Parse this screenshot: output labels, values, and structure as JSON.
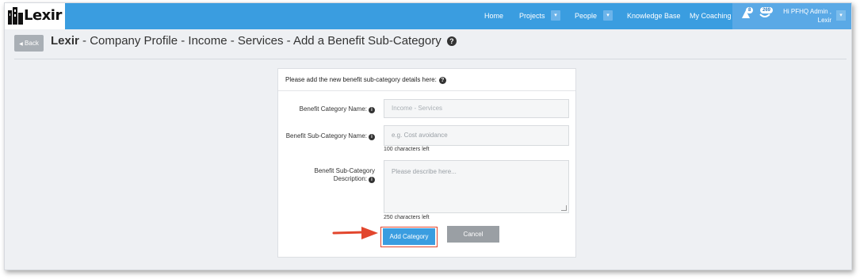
{
  "brand": {
    "logo_text": "Lexir"
  },
  "nav": {
    "items": [
      {
        "label": "Home"
      },
      {
        "label": "Projects"
      },
      {
        "label": "People"
      },
      {
        "label": "Knowledge Base"
      },
      {
        "label": "My Coaching"
      }
    ],
    "notifications": {
      "alerts_count": "8",
      "messages_count": "269"
    },
    "user_greeting_line1": "Hi PFHQ Admin ,",
    "user_greeting_line2": "Lexir"
  },
  "header": {
    "back_label": "Back",
    "title_brand": "Lexir",
    "title_rest": " - Company Profile - Income - Services - Add a Benefit Sub-Category",
    "help_glyph": "?"
  },
  "form": {
    "intro": "Please add the new benefit sub-category details here:",
    "category_label": "Benefit Category Name:",
    "category_value": "Income - Services",
    "subcategory_label": "Benefit Sub-Category Name:",
    "subcategory_placeholder": "e.g. Cost avoidance",
    "subcategory_hint": "100 characters left",
    "description_label_line1": "Benefit Sub-Category",
    "description_label_line2": "Description:",
    "description_placeholder": "Please describe here...",
    "description_hint": "250 characters left",
    "add_label": "Add Category",
    "cancel_label": "Cancel"
  },
  "colors": {
    "primary": "#3a9de0",
    "annotation": "#e2462d",
    "cancel": "#9a9fa4",
    "back": "#a9afb5"
  },
  "icons": [
    "logo-building-icon",
    "dropdown-caret-icon",
    "alert-bell-icon",
    "messages-icon",
    "help-circle-icon",
    "info-circle-icon",
    "annotation-arrow-icon"
  ]
}
